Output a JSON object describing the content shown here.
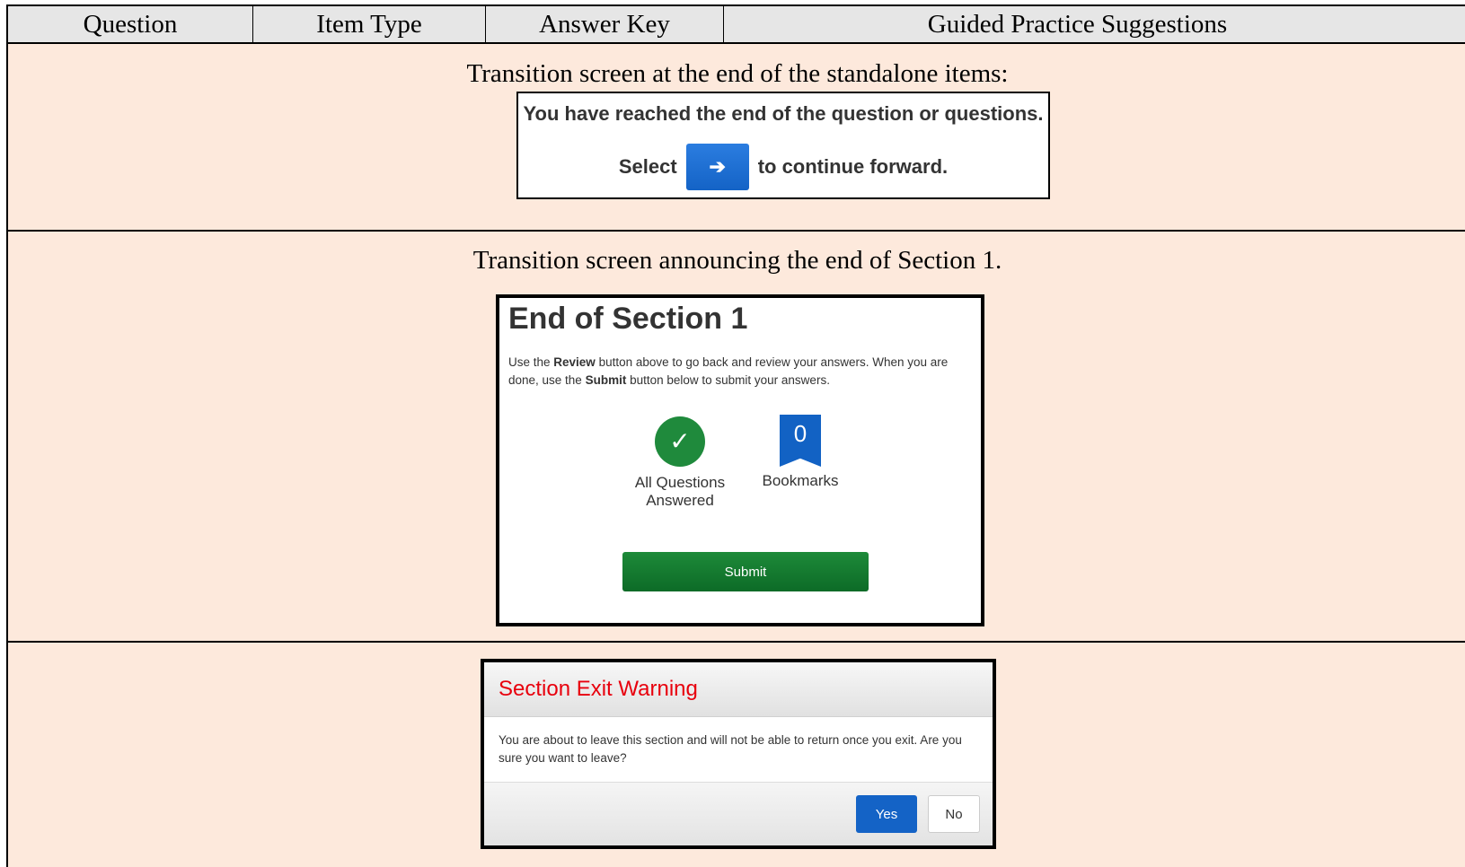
{
  "header": {
    "question": "Question",
    "item_type": "Item Type",
    "answer_key": "Answer Key",
    "guided": "Guided Practice Suggestions"
  },
  "row1": {
    "caption": "Transition screen at the end of the standalone items:",
    "line1": "You have reached the end of the question or questions.",
    "select_text": "Select",
    "continue_text": "to continue forward.",
    "arrow_glyph": "➔"
  },
  "row2": {
    "caption": "Transition screen announcing the end of Section 1.",
    "title": "End of Section 1",
    "desc_prefix": "Use the ",
    "desc_review": "Review",
    "desc_mid": " button above to go back and review your answers. When you are done, use the ",
    "desc_submit": "Submit",
    "desc_suffix": " button below to submit your answers.",
    "check_glyph": "✓",
    "answered_label": "All Questions Answered",
    "bookmark_count": "0",
    "bookmarks_label": "Bookmarks",
    "submit_label": "Submit"
  },
  "row3": {
    "title": "Section Exit Warning",
    "body": "You are about to leave this section and will not be able to return once you exit. Are you sure you want to leave?",
    "yes_label": "Yes",
    "no_label": "No"
  }
}
